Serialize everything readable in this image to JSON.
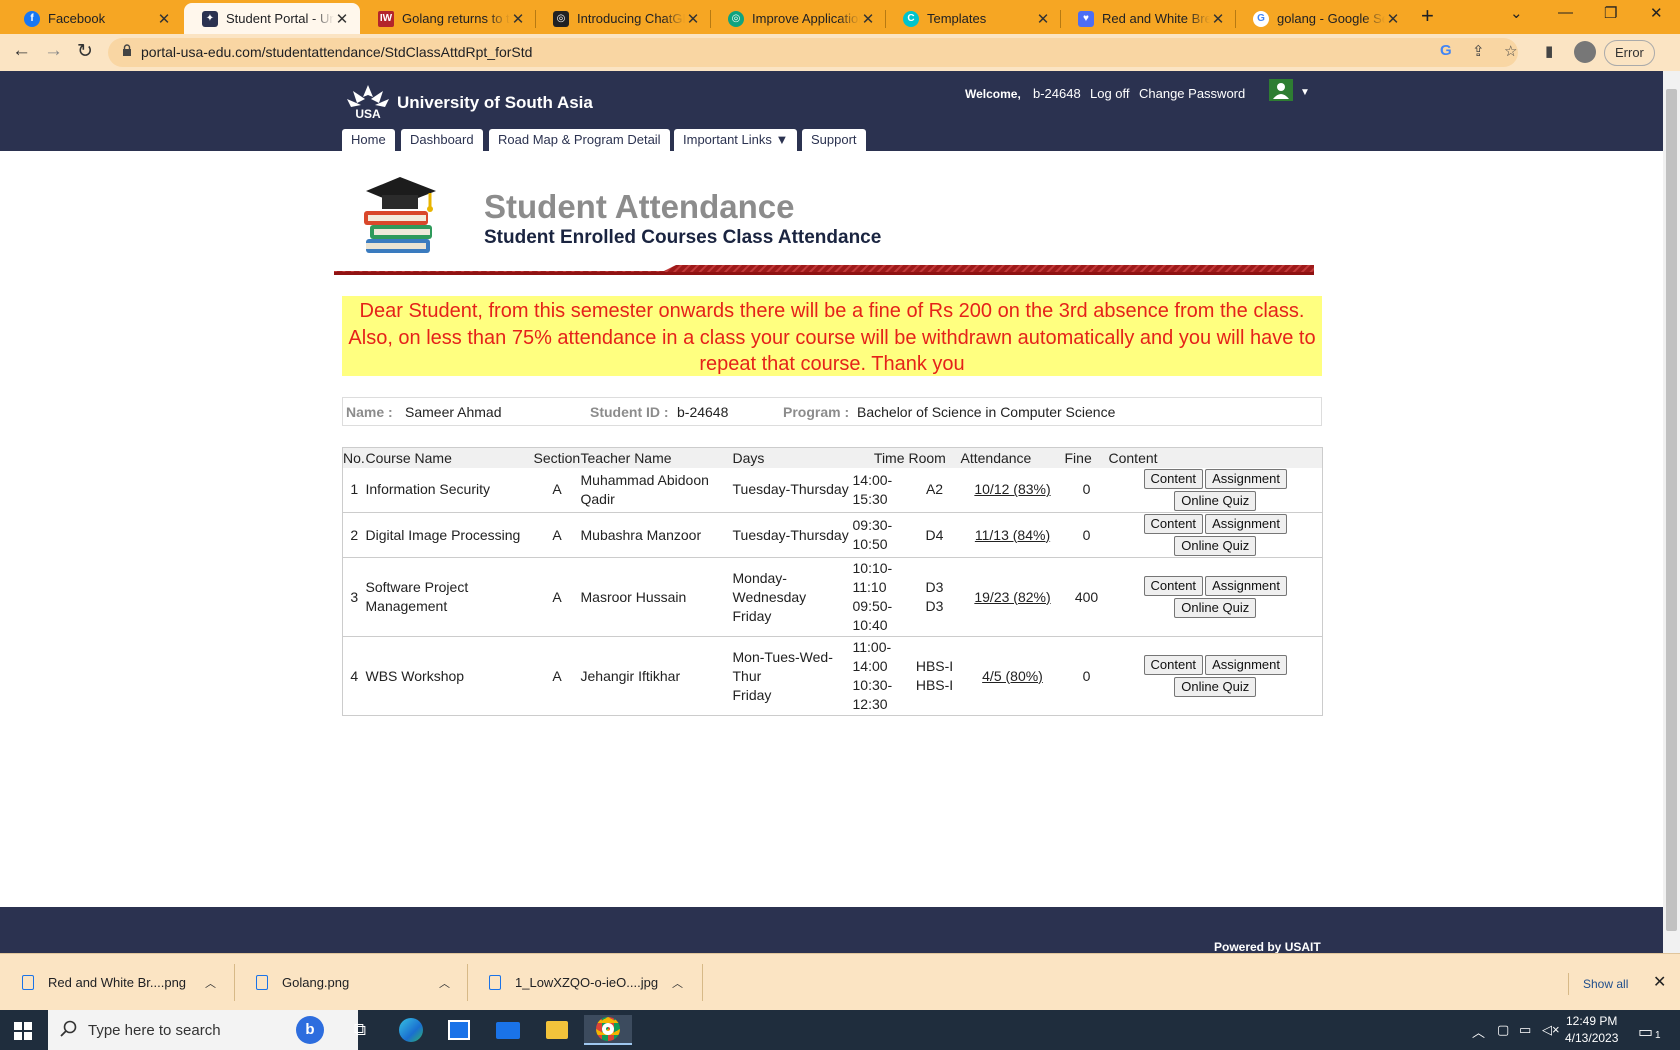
{
  "browser": {
    "tabs": [
      {
        "title": "Facebook",
        "icon": "facebook-icon",
        "color": "#1877f2"
      },
      {
        "title": "Student Portal - Univ",
        "icon": "usa-logo-icon",
        "color": "#2b3250"
      },
      {
        "title": "Golang returns to the",
        "icon": "iw-icon",
        "color": "#b3252b"
      },
      {
        "title": "Introducing ChatGPT",
        "icon": "openai-icon",
        "color": "#202123"
      },
      {
        "title": "Improve Application",
        "icon": "openai-icon",
        "color": "#10a37f"
      },
      {
        "title": "Templates",
        "icon": "canva-icon",
        "color": "#00c4cc"
      },
      {
        "title": "Red and White Break",
        "icon": "heart-icon",
        "color": "#4c6ef5"
      },
      {
        "title": "golang - Google Sea",
        "icon": "google-icon",
        "color": "#4285f4"
      }
    ],
    "url": "portal-usa-edu.com/studentattendance/StdClassAttdRpt_forStd",
    "profile_status": "Error"
  },
  "header": {
    "logo_text": "University of South Asia",
    "logo_abbr": "USA",
    "welcome_label": "Welcome,",
    "username": "b-24648",
    "logoff": "Log off",
    "change_password": "Change Password"
  },
  "nav": [
    {
      "label": "Home"
    },
    {
      "label": "Dashboard"
    },
    {
      "label": "Road Map & Program Detail"
    },
    {
      "label": "Important Links ▼"
    },
    {
      "label": "Support"
    }
  ],
  "page": {
    "title": "Student Attendance",
    "subtitle": "Student Enrolled Courses Class Attendance",
    "notice": "Dear Student, from this semester onwards there will be a fine of Rs 200 on the 3rd absence from the class. Also, on less than 75% attendance in a class your course will be withdrawn automatically and you will have to repeat that course. Thank you"
  },
  "student": {
    "name_label": "Name :",
    "name": "Sameer Ahmad",
    "id_label": "Student ID :",
    "id": "b-24648",
    "program_label": "Program :",
    "program": "Bachelor of Science in Computer Science"
  },
  "table": {
    "headers": [
      "No.",
      "Course Name",
      "Section",
      "Teacher Name",
      "Days",
      "Time",
      "Room",
      "Attendance",
      "Fine",
      "Content"
    ],
    "buttons": {
      "content": "Content",
      "assignment": "Assignment",
      "quiz": "Online Quiz"
    },
    "rows": [
      {
        "no": "1",
        "course": "Information Security",
        "section": "A",
        "teacher": "Muhammad Abidoon Qadir",
        "days": [
          "Tuesday-Thursday"
        ],
        "time": [
          "14:00-",
          "15:30"
        ],
        "room": [
          "A2"
        ],
        "attendance": "10/12 (83%)",
        "fine": "0"
      },
      {
        "no": "2",
        "course": "Digital Image Processing",
        "section": "A",
        "teacher": "Mubashra Manzoor",
        "days": [
          "Tuesday-Thursday"
        ],
        "time": [
          "09:30-",
          "10:50"
        ],
        "room": [
          "D4"
        ],
        "attendance": "11/13 (84%)",
        "fine": "0"
      },
      {
        "no": "3",
        "course": "Software Project Management",
        "section": "A",
        "teacher": "Masroor Hussain",
        "days": [
          "Monday-",
          "Wednesday",
          "Friday"
        ],
        "time": [
          "10:10-",
          "11:10",
          "09:50-",
          "10:40"
        ],
        "room": [
          "D3",
          "D3"
        ],
        "attendance": "19/23 (82%)",
        "fine": "400"
      },
      {
        "no": "4",
        "course": "WBS Workshop",
        "section": "A",
        "teacher": "Jehangir Iftikhar",
        "days": [
          "Mon-Tues-Wed-",
          "Thur",
          "Friday"
        ],
        "time": [
          "11:00-",
          "14:00",
          "10:30-",
          "12:30"
        ],
        "room": [
          "HBS-I",
          "HBS-I"
        ],
        "attendance": "4/5 (80%)",
        "fine": "0"
      }
    ]
  },
  "footer": {
    "powered": "Powered by USAIT"
  },
  "downloads": {
    "files": [
      {
        "name": "Red and White Br....png"
      },
      {
        "name": "Golang.png"
      },
      {
        "name": "1_LowXZQO-o-ieO....jpg"
      }
    ],
    "show_all": "Show all"
  },
  "taskbar": {
    "search_placeholder": "Type here to search",
    "time": "12:49 PM",
    "date": "4/13/2023",
    "notification_count": "1"
  }
}
